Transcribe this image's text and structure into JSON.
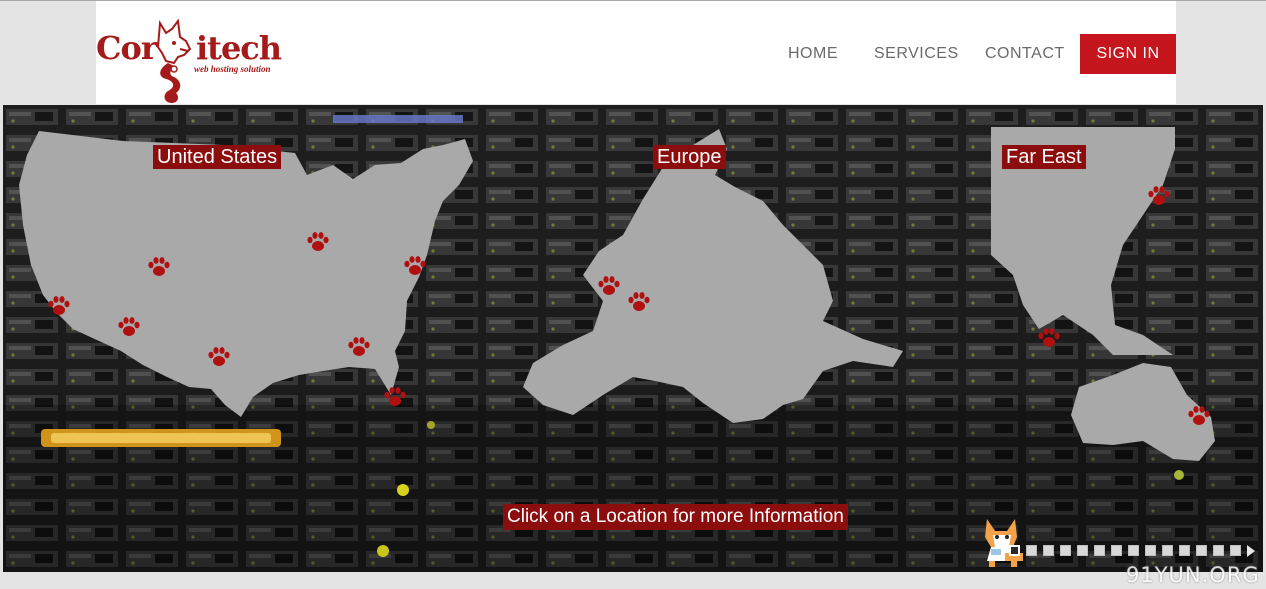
{
  "brand": {
    "name_left": "Cor",
    "name_right": "itech",
    "tagline": "web hosting solution",
    "color": "#a51b1b"
  },
  "nav": {
    "items": [
      {
        "label": "HOME"
      },
      {
        "label": "SERVICES"
      },
      {
        "label": "CONTACT"
      }
    ],
    "signin_label": "SIGN IN",
    "signin_color": "#c4161c"
  },
  "map": {
    "regions": [
      {
        "label": "United States"
      },
      {
        "label": "Europe"
      },
      {
        "label": "Far East"
      }
    ],
    "label_color": "#8c0d0d",
    "marker_icon": "paw-icon",
    "cta": "Click on a Location for more Information"
  },
  "slider": {
    "slide_count": 14,
    "active_index": 1,
    "next_icon": "play-arrow-icon"
  },
  "watermark": "91YUN.ORG"
}
